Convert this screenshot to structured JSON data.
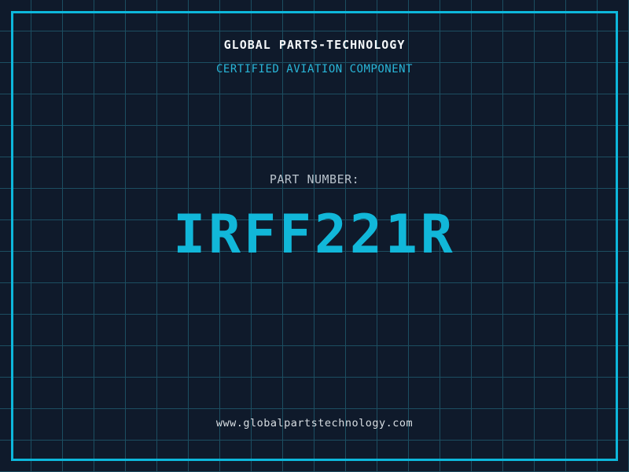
{
  "colors": {
    "background": "#0f1a2b",
    "grid_line": "#1c4e61",
    "frame_border": "#0db7db",
    "part_number_cyan": "#11b7d9",
    "certification_cyan": "#29b6d8",
    "title_white": "#f4f7f9",
    "label_gray": "#b9c3cc",
    "url_light": "#d7dde2"
  },
  "header": {
    "company_name": "GLOBAL PARTS-TECHNOLOGY",
    "certification": "CERTIFIED AVIATION COMPONENT"
  },
  "part": {
    "label": "PART NUMBER:",
    "number": "IRFF221R"
  },
  "footer": {
    "website": "www.globalpartstechnology.com"
  }
}
